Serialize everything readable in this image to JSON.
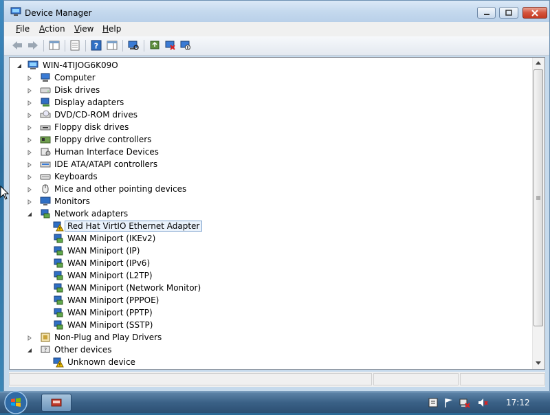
{
  "window": {
    "title": "Device Manager"
  },
  "menu": [
    {
      "key": "F",
      "rest": "ile"
    },
    {
      "key": "A",
      "rest": "ction"
    },
    {
      "key": "V",
      "rest": "iew"
    },
    {
      "key": "H",
      "rest": "elp"
    }
  ],
  "tree": {
    "root": "WIN-4TIJOG6K09O",
    "nodes": [
      {
        "label": "Computer",
        "icon": "computer-icon",
        "state": "collapsed"
      },
      {
        "label": "Disk drives",
        "icon": "disk-drive-icon",
        "state": "collapsed"
      },
      {
        "label": "Display adapters",
        "icon": "display-adapter-icon",
        "state": "collapsed"
      },
      {
        "label": "DVD/CD-ROM drives",
        "icon": "dvd-drive-icon",
        "state": "collapsed"
      },
      {
        "label": "Floppy disk drives",
        "icon": "floppy-drive-icon",
        "state": "collapsed"
      },
      {
        "label": "Floppy drive controllers",
        "icon": "floppy-controller-icon",
        "state": "collapsed"
      },
      {
        "label": "Human Interface Devices",
        "icon": "hid-icon",
        "state": "collapsed"
      },
      {
        "label": "IDE ATA/ATAPI controllers",
        "icon": "ide-controller-icon",
        "state": "collapsed"
      },
      {
        "label": "Keyboards",
        "icon": "keyboard-icon",
        "state": "collapsed"
      },
      {
        "label": "Mice and other pointing devices",
        "icon": "mouse-icon",
        "state": "collapsed"
      },
      {
        "label": "Monitors",
        "icon": "monitor-icon",
        "state": "collapsed"
      },
      {
        "label": "Network adapters",
        "icon": "network-adapter-icon",
        "state": "expanded"
      },
      {
        "label": "Red Hat VirtIO Ethernet Adapter",
        "icon": "warning-device-icon",
        "child": true,
        "selected": true
      },
      {
        "label": "WAN Miniport (IKEv2)",
        "icon": "network-adapter-icon",
        "child": true
      },
      {
        "label": "WAN Miniport (IP)",
        "icon": "network-adapter-icon",
        "child": true
      },
      {
        "label": "WAN Miniport (IPv6)",
        "icon": "network-adapter-icon",
        "child": true
      },
      {
        "label": "WAN Miniport (L2TP)",
        "icon": "network-adapter-icon",
        "child": true
      },
      {
        "label": "WAN Miniport (Network Monitor)",
        "icon": "network-adapter-icon",
        "child": true
      },
      {
        "label": "WAN Miniport (PPPOE)",
        "icon": "network-adapter-icon",
        "child": true
      },
      {
        "label": "WAN Miniport (PPTP)",
        "icon": "network-adapter-icon",
        "child": true
      },
      {
        "label": "WAN Miniport (SSTP)",
        "icon": "network-adapter-icon",
        "child": true
      },
      {
        "label": "Non-Plug and Play Drivers",
        "icon": "driver-icon",
        "state": "collapsed"
      },
      {
        "label": "Other devices",
        "icon": "other-devices-icon",
        "state": "expanded"
      },
      {
        "label": "Unknown device",
        "icon": "warning-device-icon",
        "child": true
      }
    ]
  },
  "taskbar": {
    "clock": "17:12"
  },
  "colors": {
    "title_bar": "#c5d9ee",
    "close_button": "#c43b22",
    "selection_border": "#7da2ce",
    "taskbar": "#3a6186"
  }
}
